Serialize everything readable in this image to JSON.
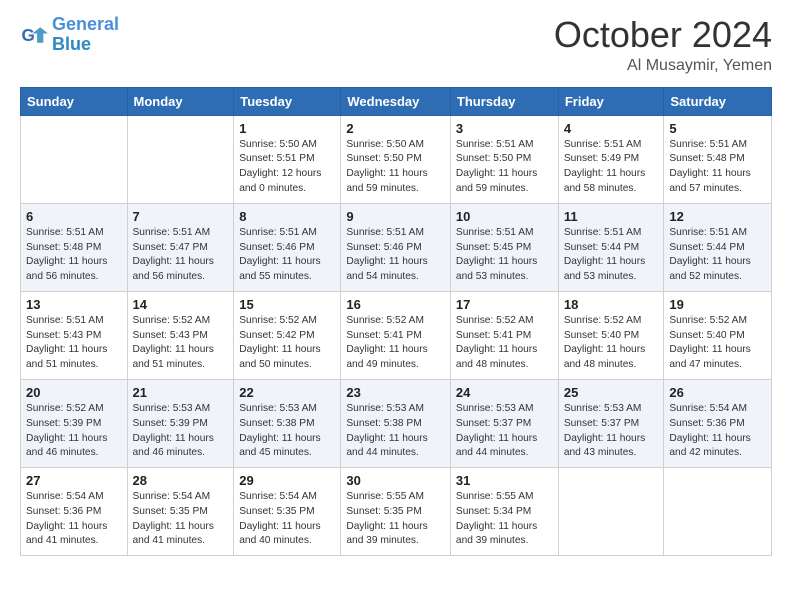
{
  "header": {
    "logo_general": "General",
    "logo_blue": "Blue",
    "month": "October 2024",
    "location": "Al Musaymir, Yemen"
  },
  "days_of_week": [
    "Sunday",
    "Monday",
    "Tuesday",
    "Wednesday",
    "Thursday",
    "Friday",
    "Saturday"
  ],
  "weeks": [
    [
      {
        "day": "",
        "sunrise": "",
        "sunset": "",
        "daylight": ""
      },
      {
        "day": "",
        "sunrise": "",
        "sunset": "",
        "daylight": ""
      },
      {
        "day": "1",
        "sunrise": "Sunrise: 5:50 AM",
        "sunset": "Sunset: 5:51 PM",
        "daylight": "Daylight: 12 hours and 0 minutes."
      },
      {
        "day": "2",
        "sunrise": "Sunrise: 5:50 AM",
        "sunset": "Sunset: 5:50 PM",
        "daylight": "Daylight: 11 hours and 59 minutes."
      },
      {
        "day": "3",
        "sunrise": "Sunrise: 5:51 AM",
        "sunset": "Sunset: 5:50 PM",
        "daylight": "Daylight: 11 hours and 59 minutes."
      },
      {
        "day": "4",
        "sunrise": "Sunrise: 5:51 AM",
        "sunset": "Sunset: 5:49 PM",
        "daylight": "Daylight: 11 hours and 58 minutes."
      },
      {
        "day": "5",
        "sunrise": "Sunrise: 5:51 AM",
        "sunset": "Sunset: 5:48 PM",
        "daylight": "Daylight: 11 hours and 57 minutes."
      }
    ],
    [
      {
        "day": "6",
        "sunrise": "Sunrise: 5:51 AM",
        "sunset": "Sunset: 5:48 PM",
        "daylight": "Daylight: 11 hours and 56 minutes."
      },
      {
        "day": "7",
        "sunrise": "Sunrise: 5:51 AM",
        "sunset": "Sunset: 5:47 PM",
        "daylight": "Daylight: 11 hours and 56 minutes."
      },
      {
        "day": "8",
        "sunrise": "Sunrise: 5:51 AM",
        "sunset": "Sunset: 5:46 PM",
        "daylight": "Daylight: 11 hours and 55 minutes."
      },
      {
        "day": "9",
        "sunrise": "Sunrise: 5:51 AM",
        "sunset": "Sunset: 5:46 PM",
        "daylight": "Daylight: 11 hours and 54 minutes."
      },
      {
        "day": "10",
        "sunrise": "Sunrise: 5:51 AM",
        "sunset": "Sunset: 5:45 PM",
        "daylight": "Daylight: 11 hours and 53 minutes."
      },
      {
        "day": "11",
        "sunrise": "Sunrise: 5:51 AM",
        "sunset": "Sunset: 5:44 PM",
        "daylight": "Daylight: 11 hours and 53 minutes."
      },
      {
        "day": "12",
        "sunrise": "Sunrise: 5:51 AM",
        "sunset": "Sunset: 5:44 PM",
        "daylight": "Daylight: 11 hours and 52 minutes."
      }
    ],
    [
      {
        "day": "13",
        "sunrise": "Sunrise: 5:51 AM",
        "sunset": "Sunset: 5:43 PM",
        "daylight": "Daylight: 11 hours and 51 minutes."
      },
      {
        "day": "14",
        "sunrise": "Sunrise: 5:52 AM",
        "sunset": "Sunset: 5:43 PM",
        "daylight": "Daylight: 11 hours and 51 minutes."
      },
      {
        "day": "15",
        "sunrise": "Sunrise: 5:52 AM",
        "sunset": "Sunset: 5:42 PM",
        "daylight": "Daylight: 11 hours and 50 minutes."
      },
      {
        "day": "16",
        "sunrise": "Sunrise: 5:52 AM",
        "sunset": "Sunset: 5:41 PM",
        "daylight": "Daylight: 11 hours and 49 minutes."
      },
      {
        "day": "17",
        "sunrise": "Sunrise: 5:52 AM",
        "sunset": "Sunset: 5:41 PM",
        "daylight": "Daylight: 11 hours and 48 minutes."
      },
      {
        "day": "18",
        "sunrise": "Sunrise: 5:52 AM",
        "sunset": "Sunset: 5:40 PM",
        "daylight": "Daylight: 11 hours and 48 minutes."
      },
      {
        "day": "19",
        "sunrise": "Sunrise: 5:52 AM",
        "sunset": "Sunset: 5:40 PM",
        "daylight": "Daylight: 11 hours and 47 minutes."
      }
    ],
    [
      {
        "day": "20",
        "sunrise": "Sunrise: 5:52 AM",
        "sunset": "Sunset: 5:39 PM",
        "daylight": "Daylight: 11 hours and 46 minutes."
      },
      {
        "day": "21",
        "sunrise": "Sunrise: 5:53 AM",
        "sunset": "Sunset: 5:39 PM",
        "daylight": "Daylight: 11 hours and 46 minutes."
      },
      {
        "day": "22",
        "sunrise": "Sunrise: 5:53 AM",
        "sunset": "Sunset: 5:38 PM",
        "daylight": "Daylight: 11 hours and 45 minutes."
      },
      {
        "day": "23",
        "sunrise": "Sunrise: 5:53 AM",
        "sunset": "Sunset: 5:38 PM",
        "daylight": "Daylight: 11 hours and 44 minutes."
      },
      {
        "day": "24",
        "sunrise": "Sunrise: 5:53 AM",
        "sunset": "Sunset: 5:37 PM",
        "daylight": "Daylight: 11 hours and 44 minutes."
      },
      {
        "day": "25",
        "sunrise": "Sunrise: 5:53 AM",
        "sunset": "Sunset: 5:37 PM",
        "daylight": "Daylight: 11 hours and 43 minutes."
      },
      {
        "day": "26",
        "sunrise": "Sunrise: 5:54 AM",
        "sunset": "Sunset: 5:36 PM",
        "daylight": "Daylight: 11 hours and 42 minutes."
      }
    ],
    [
      {
        "day": "27",
        "sunrise": "Sunrise: 5:54 AM",
        "sunset": "Sunset: 5:36 PM",
        "daylight": "Daylight: 11 hours and 41 minutes."
      },
      {
        "day": "28",
        "sunrise": "Sunrise: 5:54 AM",
        "sunset": "Sunset: 5:35 PM",
        "daylight": "Daylight: 11 hours and 41 minutes."
      },
      {
        "day": "29",
        "sunrise": "Sunrise: 5:54 AM",
        "sunset": "Sunset: 5:35 PM",
        "daylight": "Daylight: 11 hours and 40 minutes."
      },
      {
        "day": "30",
        "sunrise": "Sunrise: 5:55 AM",
        "sunset": "Sunset: 5:35 PM",
        "daylight": "Daylight: 11 hours and 39 minutes."
      },
      {
        "day": "31",
        "sunrise": "Sunrise: 5:55 AM",
        "sunset": "Sunset: 5:34 PM",
        "daylight": "Daylight: 11 hours and 39 minutes."
      },
      {
        "day": "",
        "sunrise": "",
        "sunset": "",
        "daylight": ""
      },
      {
        "day": "",
        "sunrise": "",
        "sunset": "",
        "daylight": ""
      }
    ]
  ]
}
